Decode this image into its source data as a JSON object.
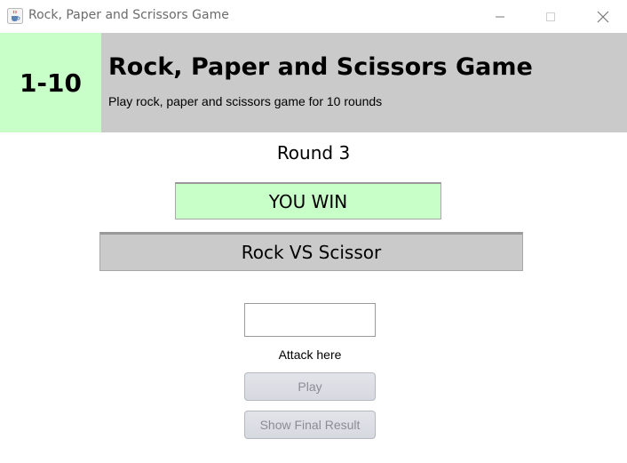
{
  "window": {
    "title": "Rock, Paper and Scrissors Game",
    "app_icon": "java-cup-icon"
  },
  "header": {
    "round_range": "1-10",
    "title": "Rock, Paper and Scissors Game",
    "subtitle": "Play rock, paper and scissors game for 10 rounds"
  },
  "game": {
    "round_label": "Round 3",
    "result": "YOU WIN",
    "matchup": "Rock VS Scissor",
    "attack_input_value": "",
    "attack_label": "Attack here",
    "play_button": "Play",
    "final_result_button": "Show Final Result"
  },
  "colors": {
    "accent_green": "#c8ffc8",
    "header_gray": "#cacaca"
  }
}
